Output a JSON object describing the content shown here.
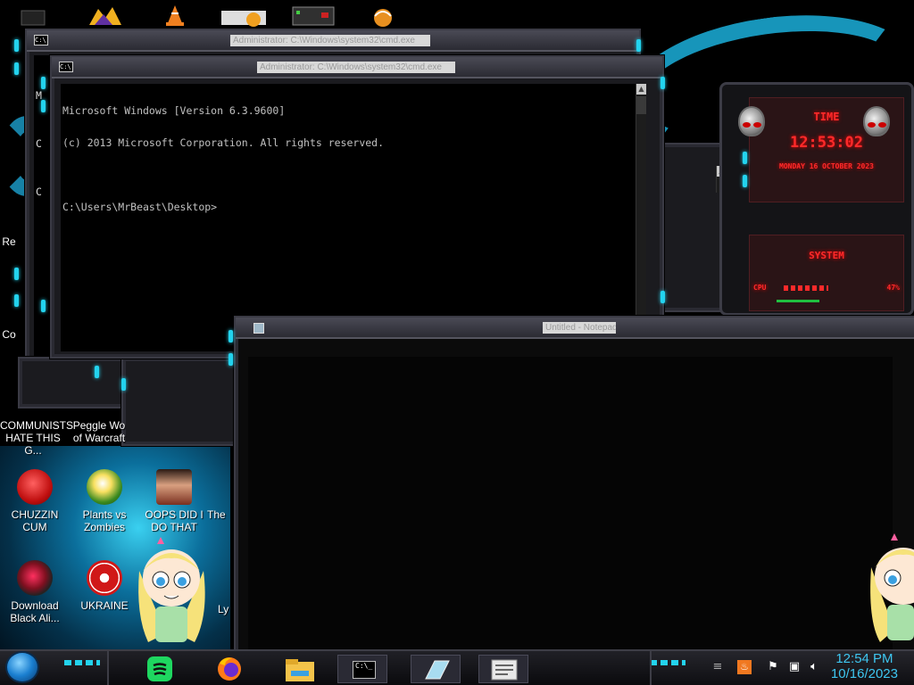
{
  "desktop": {
    "icons": [
      {
        "label_line1": "COMMUNISTS",
        "label_line2": "HATE THIS G..."
      },
      {
        "label_line1": "Peggle Wo",
        "label_line2": "of Warcraft"
      },
      {
        "label_line1": "CHUZZIN",
        "label_line2": "CUM"
      },
      {
        "label_line1": "Plants vs",
        "label_line2": "Zombies"
      },
      {
        "label_line1": "OOPS DID I",
        "label_line2": "DO THAT"
      },
      {
        "label_line1": "The",
        "label_line2": ""
      },
      {
        "label_line1": "Download",
        "label_line2": "Black Ali..."
      },
      {
        "label_line1": "UKRAINE",
        "label_line2": ""
      },
      {
        "label_line1": "Ly",
        "label_line2": ""
      },
      {
        "label_line1": "Re",
        "label_line2": ""
      },
      {
        "label_line1": "Co",
        "label_line2": ""
      }
    ]
  },
  "windows": {
    "back_cmd": {
      "title": "Administrator: C:\\Windows\\system32\\cmd.exe",
      "left_glyphs": [
        "M",
        "C",
        "C"
      ]
    },
    "front_cmd": {
      "title": "Administrator: C:\\Windows\\system32\\cmd.exe",
      "line1": "Microsoft Windows [Version 6.3.9600]",
      "line2": "(c) 2013 Microsoft Corporation. All rights reserved.",
      "line3": "",
      "line4": "C:\\Users\\MrBeast\\Desktop>"
    },
    "blank_window": {
      "title": "Untitled - Notepad"
    }
  },
  "gadget": {
    "time_label": "TIME",
    "time_value": "12:53:02",
    "date_value": "MONDAY 16 OCTOBER 2023",
    "system_label": "SYSTEM",
    "cpu_label": "CPU",
    "cpu_value": "47%"
  },
  "taskbar": {
    "time": "12:54 PM",
    "date": "10/16/2023"
  },
  "colors": {
    "accent": "#23d3ee",
    "alien_red": "#ff2a2a",
    "clock": "#3ec6f0"
  }
}
